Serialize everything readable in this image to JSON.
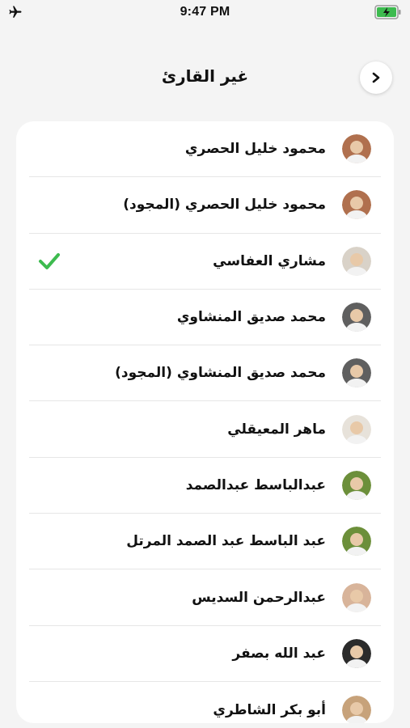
{
  "status_bar": {
    "time": "9:47 PM",
    "left_icon": "airplane-icon",
    "right_icon": "battery-charging-icon"
  },
  "header": {
    "title": "غير القارئ",
    "back_icon": "chevron-right-icon"
  },
  "colors": {
    "background": "#f4f4f4",
    "card": "#ffffff",
    "check": "#3dbb4f",
    "battery": "#3dbb4f"
  },
  "reciters": {
    "items": [
      {
        "name": "محمود خليل الحصري",
        "selected": false,
        "avatar_color": "#b0704e"
      },
      {
        "name": "محمود خليل الحصري (المجود)",
        "selected": false,
        "avatar_color": "#b0704e"
      },
      {
        "name": "مشاري العفاسي",
        "selected": true,
        "avatar_color": "#d9d2c8"
      },
      {
        "name": "محمد صديق المنشاوي",
        "selected": false,
        "avatar_color": "#5f5f5f"
      },
      {
        "name": "محمد صديق المنشاوي (المجود)",
        "selected": false,
        "avatar_color": "#5f5f5f"
      },
      {
        "name": "ماهر المعيقلي",
        "selected": false,
        "avatar_color": "#e7e2da"
      },
      {
        "name": "عبدالباسط عبدالصمد",
        "selected": false,
        "avatar_color": "#6c8f3a"
      },
      {
        "name": "عبد الباسط عبد الصمد المرتل",
        "selected": false,
        "avatar_color": "#6c8f3a"
      },
      {
        "name": "عبدالرحمن السديس",
        "selected": false,
        "avatar_color": "#d8b49a"
      },
      {
        "name": "عبد الله بصفر",
        "selected": false,
        "avatar_color": "#2b2b2b"
      },
      {
        "name": "أبو بكر الشاطري",
        "selected": false,
        "avatar_color": "#c7a27a"
      }
    ]
  }
}
